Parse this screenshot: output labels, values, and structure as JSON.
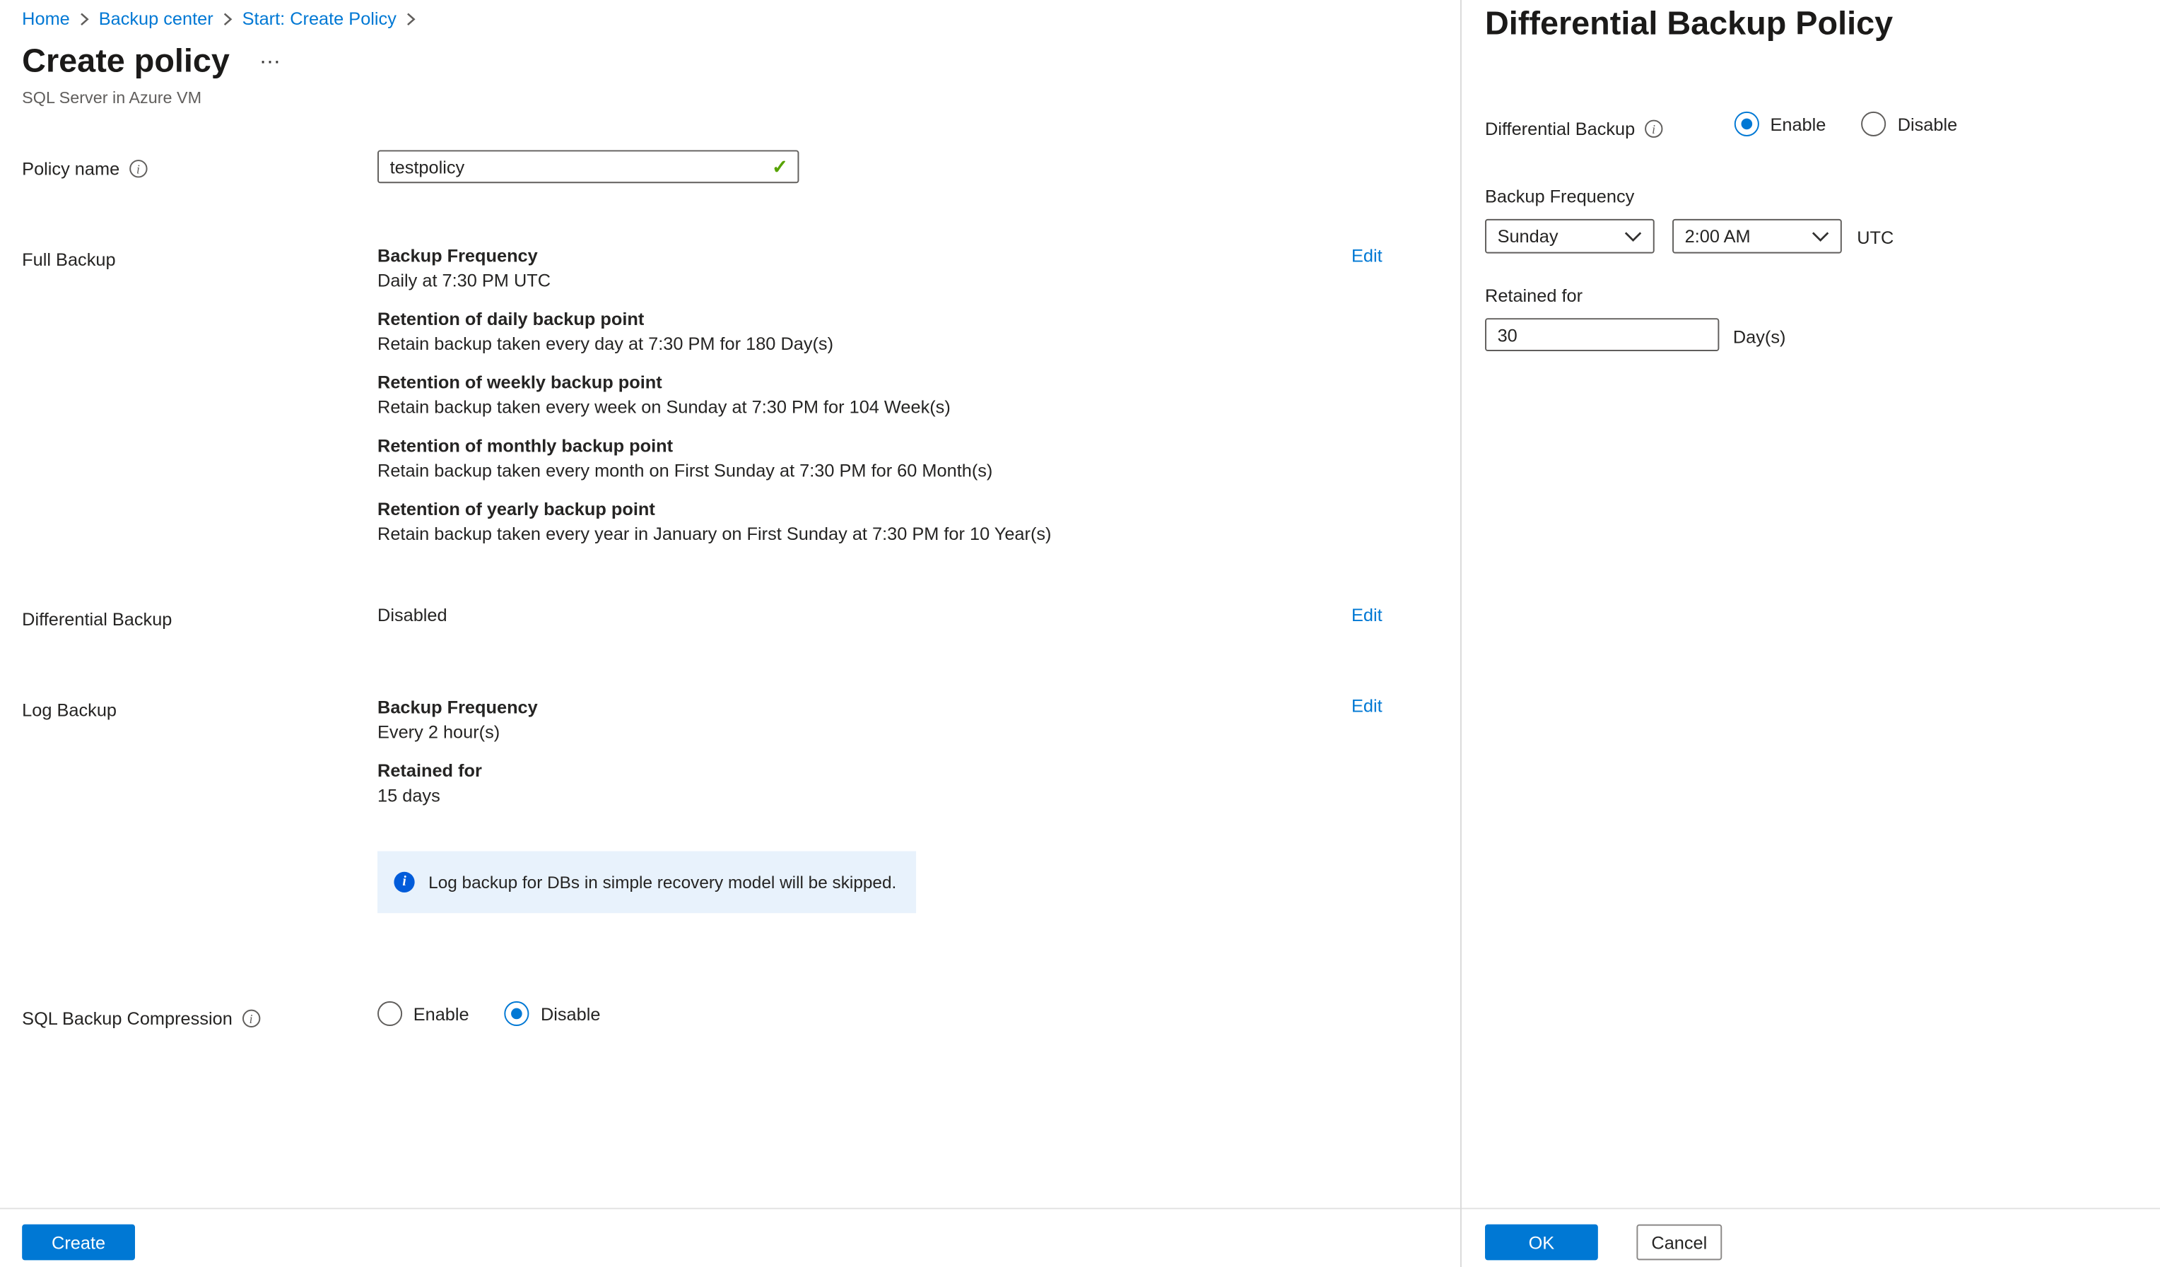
{
  "breadcrumb": {
    "items": [
      "Home",
      "Backup center",
      "Start: Create Policy"
    ]
  },
  "page": {
    "title": "Create policy",
    "subtitle": "SQL Server in Azure VM"
  },
  "form": {
    "policy_name": {
      "label": "Policy name",
      "value": "testpolicy"
    },
    "full_backup": {
      "label": "Full Backup",
      "edit_label": "Edit",
      "items": [
        {
          "title": "Backup Frequency",
          "desc": "Daily at 7:30 PM UTC"
        },
        {
          "title": "Retention of daily backup point",
          "desc": "Retain backup taken every day at 7:30 PM for 180 Day(s)"
        },
        {
          "title": "Retention of weekly backup point",
          "desc": "Retain backup taken every week on Sunday at 7:30 PM for 104 Week(s)"
        },
        {
          "title": "Retention of monthly backup point",
          "desc": "Retain backup taken every month on First Sunday at 7:30 PM for 60 Month(s)"
        },
        {
          "title": "Retention of yearly backup point",
          "desc": "Retain backup taken every year in January on First Sunday at 7:30 PM for 10 Year(s)"
        }
      ]
    },
    "differential_backup": {
      "label": "Differential Backup",
      "value": "Disabled",
      "edit_label": "Edit"
    },
    "log_backup": {
      "label": "Log Backup",
      "edit_label": "Edit",
      "items": [
        {
          "title": "Backup Frequency",
          "desc": "Every 2 hour(s)"
        },
        {
          "title": "Retained for",
          "desc": "15 days"
        }
      ],
      "info_message": "Log backup for DBs in simple recovery model will be skipped."
    },
    "sql_backup_compression": {
      "label": "SQL Backup Compression",
      "enable_label": "Enable",
      "disable_label": "Disable",
      "selected": "Disable"
    },
    "create_button": "Create"
  },
  "panel": {
    "title": "Differential Backup Policy",
    "differential_backup": {
      "label": "Differential Backup",
      "enable_label": "Enable",
      "disable_label": "Disable",
      "selected": "Enable"
    },
    "backup_frequency": {
      "label": "Backup Frequency",
      "day": "Sunday",
      "time": "2:00 AM",
      "timezone": "UTC"
    },
    "retained_for": {
      "label": "Retained for",
      "value": "30",
      "unit": "Day(s)"
    },
    "ok_button": "OK",
    "cancel_button": "Cancel"
  },
  "colors": {
    "accent": "#0078d4",
    "success_check": "#57a300",
    "info_icon_fill": "#015cda",
    "info_banner_bg": "#e8f2fc"
  }
}
